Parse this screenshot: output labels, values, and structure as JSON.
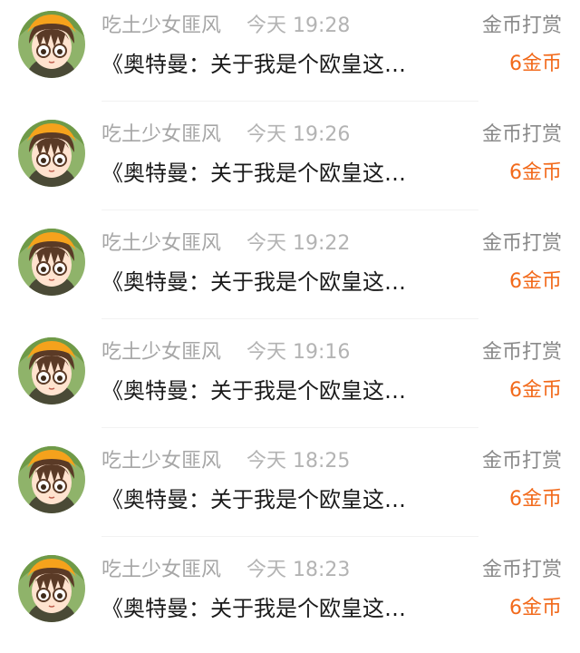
{
  "rows": [
    {
      "name": "吃土少女匪风",
      "time": "今天 19:28",
      "action": "金币打赏",
      "message": "《奥特曼：关于我是个欧皇这…",
      "amount": "6金币"
    },
    {
      "name": "吃土少女匪风",
      "time": "今天 19:26",
      "action": "金币打赏",
      "message": "《奥特曼：关于我是个欧皇这…",
      "amount": "6金币"
    },
    {
      "name": "吃土少女匪风",
      "time": "今天 19:22",
      "action": "金币打赏",
      "message": "《奥特曼：关于我是个欧皇这…",
      "amount": "6金币"
    },
    {
      "name": "吃土少女匪风",
      "time": "今天 19:16",
      "action": "金币打赏",
      "message": "《奥特曼：关于我是个欧皇这…",
      "amount": "6金币"
    },
    {
      "name": "吃土少女匪风",
      "time": "今天 18:25",
      "action": "金币打赏",
      "message": "《奥特曼：关于我是个欧皇这…",
      "amount": "6金币"
    },
    {
      "name": "吃土少女匪风",
      "time": "今天 18:23",
      "action": "金币打赏",
      "message": "《奥特曼：关于我是个欧皇这…",
      "amount": "6金币"
    }
  ],
  "colors": {
    "name": "#a6a6a6",
    "time": "#b3b3b3",
    "action": "#8a8a8a",
    "message": "#1a1a1a",
    "amount": "#f26a1b"
  },
  "icons": {
    "avatar": "anime-girl-avatar-icon"
  }
}
